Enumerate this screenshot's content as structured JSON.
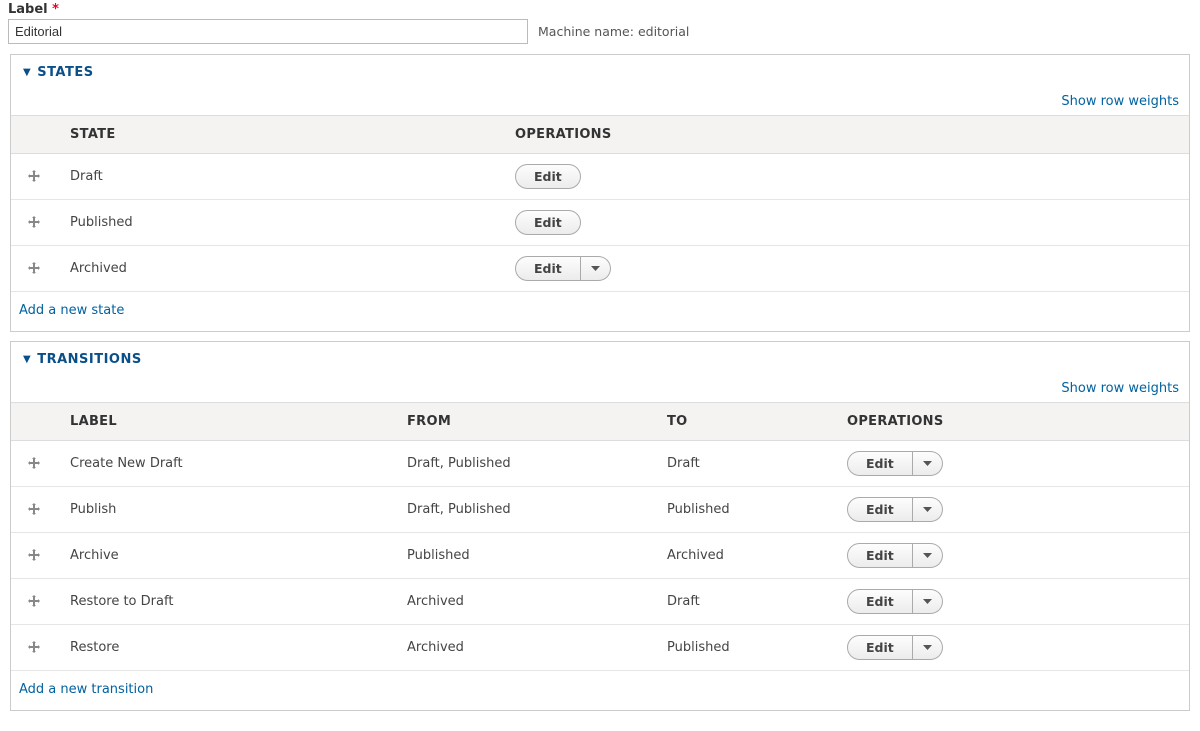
{
  "label_field": {
    "label": "Label",
    "required_mark": "*",
    "value": "Editorial",
    "machine_prefix": "Machine name: ",
    "machine_name": "editorial"
  },
  "states_section": {
    "title": "STATES",
    "show_row_weights": "Show row weights",
    "headers": {
      "state": "STATE",
      "operations": "OPERATIONS"
    },
    "rows": [
      {
        "label": "Draft",
        "edit": "Edit",
        "has_dropdown": false
      },
      {
        "label": "Published",
        "edit": "Edit",
        "has_dropdown": false
      },
      {
        "label": "Archived",
        "edit": "Edit",
        "has_dropdown": true
      }
    ],
    "add_link": "Add a new state"
  },
  "transitions_section": {
    "title": "TRANSITIONS",
    "show_row_weights": "Show row weights",
    "headers": {
      "label": "LABEL",
      "from": "FROM",
      "to": "TO",
      "operations": "OPERATIONS"
    },
    "rows": [
      {
        "label": "Create New Draft",
        "from": "Draft, Published",
        "to": "Draft",
        "edit": "Edit"
      },
      {
        "label": "Publish",
        "from": "Draft, Published",
        "to": "Published",
        "edit": "Edit"
      },
      {
        "label": "Archive",
        "from": "Published",
        "to": "Archived",
        "edit": "Edit"
      },
      {
        "label": "Restore to Draft",
        "from": "Archived",
        "to": "Draft",
        "edit": "Edit"
      },
      {
        "label": "Restore",
        "from": "Archived",
        "to": "Published",
        "edit": "Edit"
      }
    ],
    "add_link": "Add a new transition"
  }
}
